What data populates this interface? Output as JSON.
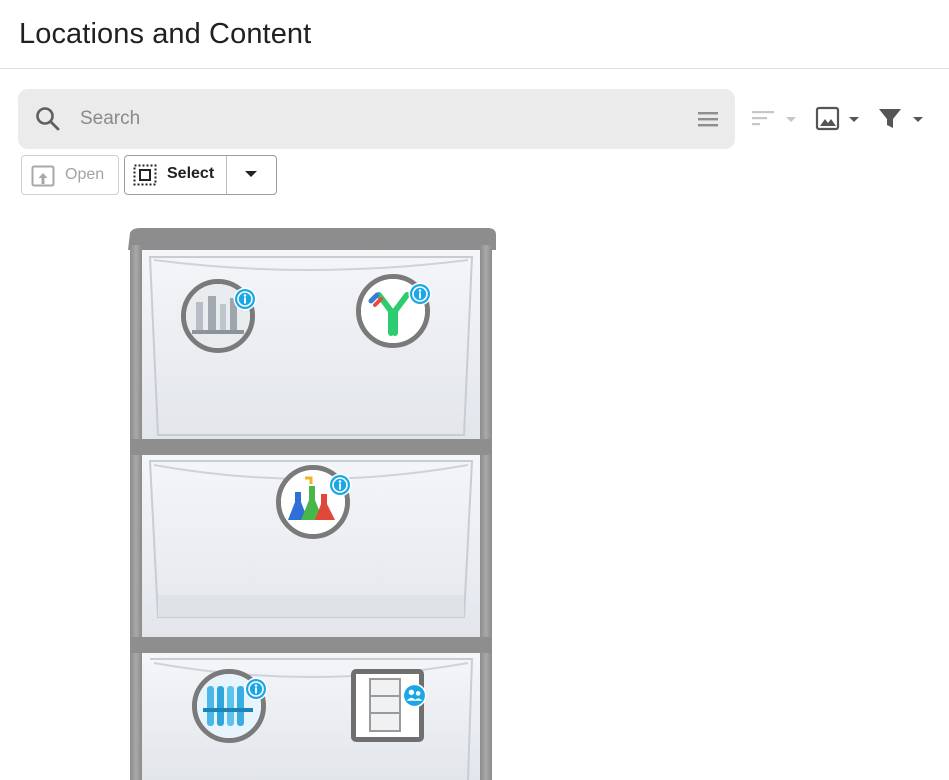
{
  "header": {
    "title": "Locations and Content"
  },
  "search": {
    "placeholder": "Search",
    "value": ""
  },
  "toolbar": {
    "open_label": "Open",
    "select_label": "Select"
  },
  "icons": {
    "search": "search-icon",
    "menu": "menu-icon",
    "sort": "sort-icon",
    "image": "image-icon",
    "filter": "filter-icon",
    "open": "open-icon",
    "select": "select-icon",
    "dropdown": "caret-down-icon",
    "info": "info-icon",
    "group": "group-icon"
  },
  "colors": {
    "accent": "#1aa7e6",
    "marker_ring": "#7a7a7a",
    "search_bg": "#ebebeb"
  },
  "location_image": {
    "name": "plastic-drawer-cabinet"
  },
  "markers": [
    {
      "name": "lab-glassware-item",
      "badge": "info"
    },
    {
      "name": "antibody-item",
      "badge": "info"
    },
    {
      "name": "chemical-flasks-item",
      "badge": "info"
    },
    {
      "name": "test-tubes-item",
      "badge": "info"
    },
    {
      "name": "drawer-cabinet-sublocation",
      "badge": "group"
    }
  ]
}
